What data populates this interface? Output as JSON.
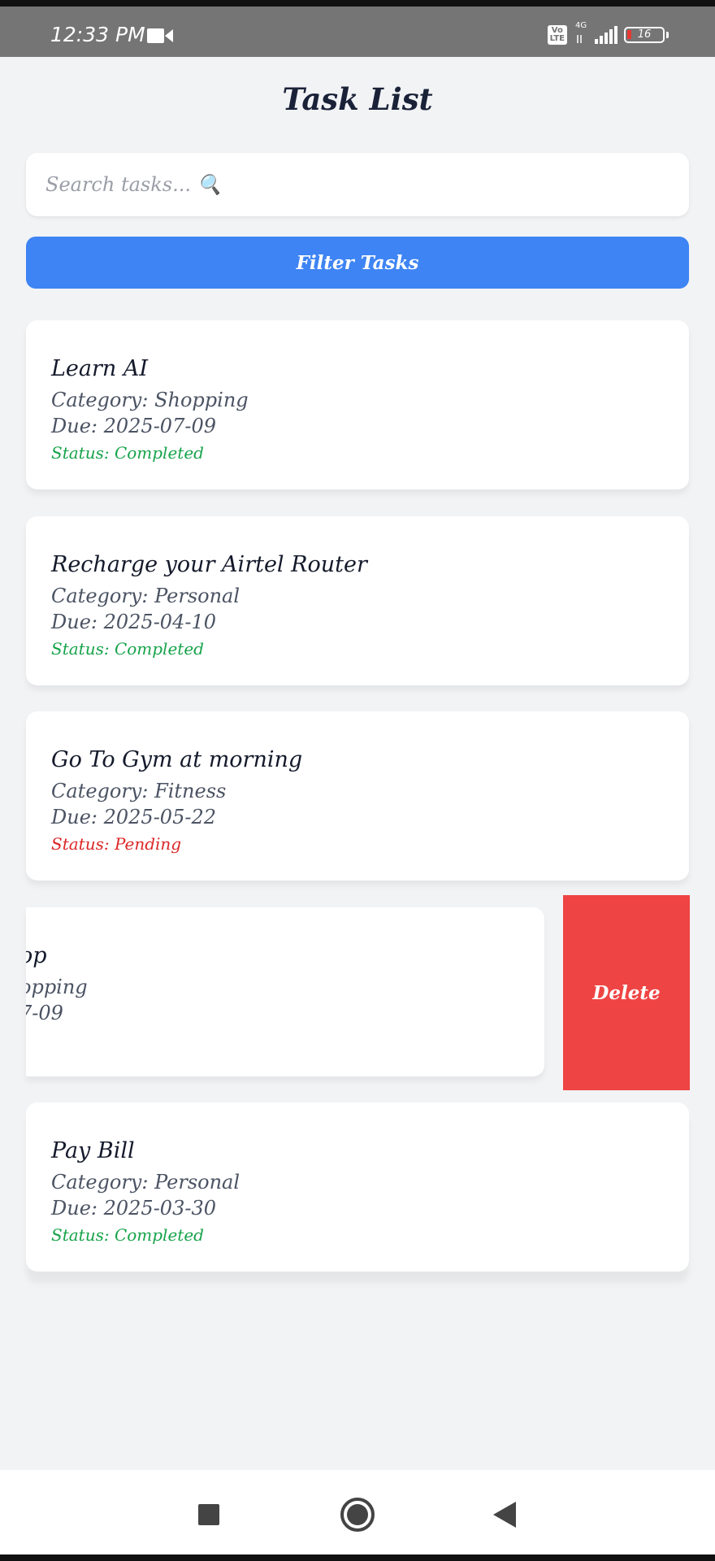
{
  "status_bar": {
    "time": "12:33 PM",
    "network_badge": "Vo\nLTE",
    "network_type": "4G",
    "battery": "16"
  },
  "header": {
    "title": "Task List"
  },
  "search": {
    "placeholder": "Search tasks... 🔍",
    "value": ""
  },
  "filter_button": {
    "label": "Filter Tasks"
  },
  "tasks": [
    {
      "title": "Learn AI",
      "category": "Category: Shopping",
      "due": "Due: 2025-07-09",
      "status": "Status: Completed"
    },
    {
      "title": "Recharge your Airtel Router",
      "category": "Category: Personal",
      "due": "Due: 2025-04-10",
      "status": "Status: Completed"
    },
    {
      "title": "Go To Gym at morning",
      "category": "Category: Fitness",
      "due": "Due: 2025-05-22",
      "status": "Status: Pending"
    },
    {
      "title_visible": "op",
      "category_visible": "opping",
      "due_visible": "7-09"
    },
    {
      "title": "Pay Bill",
      "category": "Category: Personal",
      "due": "Due: 2025-03-30",
      "status": "Status: Completed"
    }
  ],
  "swipe_action": {
    "delete_label": "Delete"
  },
  "colors": {
    "accent": "#3e84f4",
    "delete": "#ef4444",
    "completed": "#16a34a",
    "pending": "#dc2626",
    "background": "#f2f3f5"
  },
  "nav_bar": {
    "icons": [
      "recents-square-icon",
      "home-circle-icon",
      "back-triangle-icon"
    ]
  }
}
